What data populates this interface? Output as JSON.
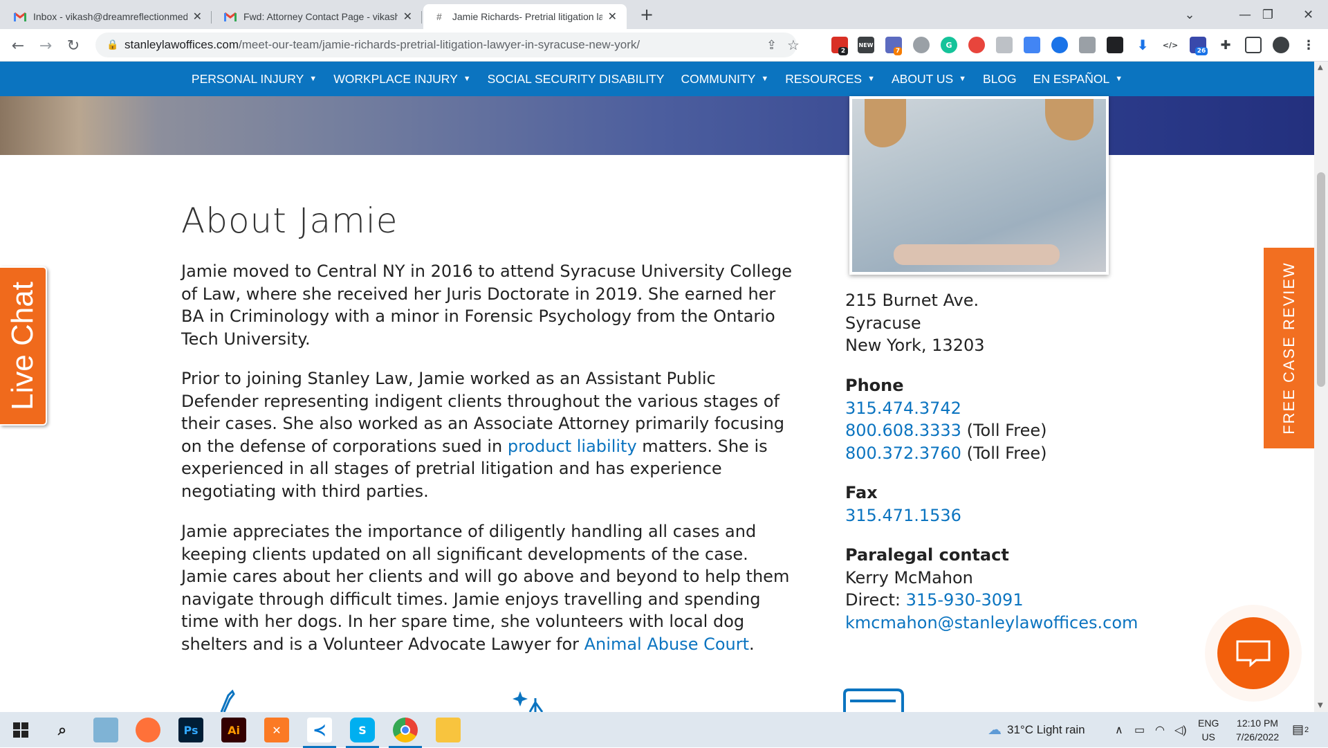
{
  "browser": {
    "tabs": [
      {
        "title": "Inbox - vikash@dreamreflectionmedia.com",
        "favicon": "gmail-icon"
      },
      {
        "title": "Fwd: Attorney Contact Page - vikash",
        "favicon": "gmail-icon"
      },
      {
        "title": "Jamie Richards- Pretrial litigation lawyer",
        "favicon": "site-icon",
        "active": true
      }
    ],
    "url_host": "stanleylawoffices.com",
    "url_path": "/meet-our-team/jamie-richards-pretrial-litigation-lawyer-in-syracuse-new-york/",
    "extension_badges": [
      "2",
      "NEW",
      "7",
      "26"
    ]
  },
  "nav": {
    "items": [
      {
        "label": "PERSONAL INJURY",
        "dropdown": true
      },
      {
        "label": "WORKPLACE INJURY",
        "dropdown": true
      },
      {
        "label": "SOCIAL SECURITY DISABILITY",
        "dropdown": false
      },
      {
        "label": "COMMUNITY",
        "dropdown": true
      },
      {
        "label": "RESOURCES",
        "dropdown": true
      },
      {
        "label": "ABOUT US",
        "dropdown": true
      },
      {
        "label": "BLOG",
        "dropdown": false
      },
      {
        "label": "EN ESPAÑOL",
        "dropdown": true
      }
    ]
  },
  "about": {
    "heading": "About Jamie",
    "p1": "Jamie moved to Central NY in 2016 to attend Syracuse University College of Law, where she received her Juris Doctorate in 2019. She earned her BA in Criminology with a minor in Forensic Psychology from the Ontario Tech University.",
    "p2_before": "Prior to joining Stanley Law, Jamie worked as an Assistant Public Defender representing indigent clients throughout the various stages of their cases. She also worked as an Associate Attorney primarily focusing on the defense of corporations sued in ",
    "p2_link": "product liability",
    "p2_after": " matters. She is experienced in all stages of pretrial litigation and has experience negotiating with third parties.",
    "p3_before": "Jamie appreciates the importance of diligently handling all cases and keeping clients updated on all significant developments of the case. Jamie cares about her clients and will go above and beyond to help them navigate through difficult times. Jamie enjoys travelling and spending time with her dogs. In her spare time, she volunteers with local dog shelters and is a Volunteer Advocate Lawyer for ",
    "p3_link": "Animal Abuse Court",
    "p3_after": "."
  },
  "contact": {
    "address_line1": "215 Burnet Ave.",
    "address_line2": "Syracuse",
    "address_line3": "New York, 13203",
    "phone_label": "Phone",
    "phone1": "315.474.3742",
    "phone2": "800.608.3333",
    "phone2_note": " (Toll Free)",
    "phone3": "800.372.3760",
    "phone3_note": " (Toll Free)",
    "fax_label": "Fax",
    "fax": "315.471.1536",
    "paralegal_label": "Paralegal contact",
    "paralegal_name": "Kerry McMahon",
    "direct_label": "Direct: ",
    "direct_phone": "315-930-3091",
    "email": "kmcmahon@stanleylawoffices.com"
  },
  "widgets": {
    "live_chat": "Live Chat",
    "free_case_review": "FREE CASE REVIEW"
  },
  "taskbar": {
    "weather": "31°C  Light rain",
    "lang_top": "ENG",
    "lang_bottom": "US",
    "time": "12:10 PM",
    "date": "7/26/2022",
    "notif_count": "2",
    "apps": [
      "windows-start-icon",
      "search-icon",
      "files-icon",
      "firefox-icon",
      "photoshop-icon",
      "illustrator-icon",
      "xampp-icon",
      "vscode-icon",
      "skype-icon",
      "chrome-icon",
      "file-explorer-icon"
    ]
  },
  "colors": {
    "brand_blue": "#0b74c0",
    "accent_orange": "#f26f21"
  }
}
